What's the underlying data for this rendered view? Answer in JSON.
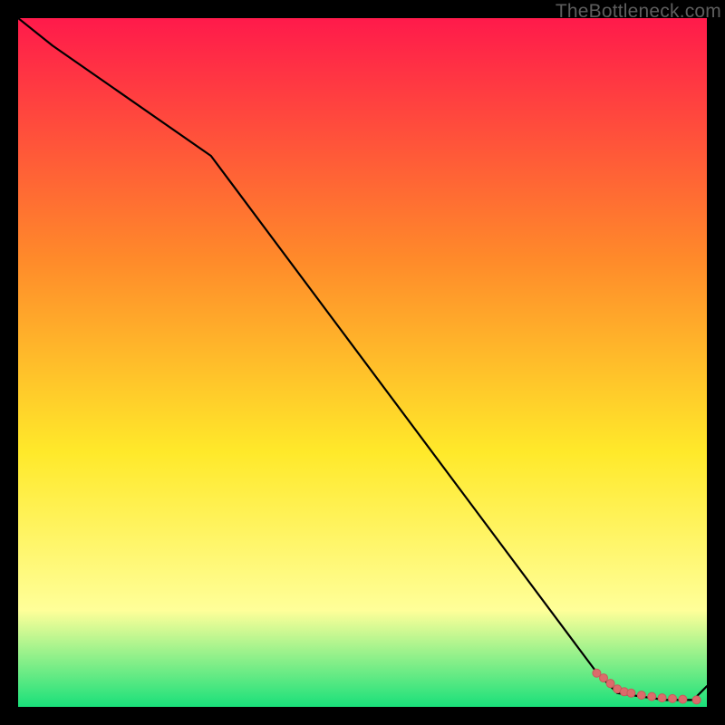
{
  "watermark": "TheBottleneck.com",
  "colors": {
    "gradient_top": "#ff1a4b",
    "gradient_mid1": "#ff8a2a",
    "gradient_mid2": "#ffe92a",
    "gradient_mid3": "#ffff99",
    "gradient_bottom": "#19e07a",
    "line": "#000000",
    "marker_fill": "#dc6b6b",
    "marker_stroke": "#c85a5a"
  },
  "chart_data": {
    "type": "line",
    "title": "",
    "xlabel": "",
    "ylabel": "",
    "xlim": [
      0,
      100
    ],
    "ylim": [
      0,
      100
    ],
    "series": [
      {
        "name": "curve",
        "x": [
          0,
          5,
          28,
          84,
          87,
          94,
          98,
          100
        ],
        "values": [
          100,
          96,
          80,
          5,
          2,
          1,
          1,
          3
        ]
      }
    ],
    "markers": {
      "name": "highlight-span",
      "x": [
        84.0,
        85.0,
        86.0,
        87.0,
        88.0,
        89.0,
        90.5,
        92.0,
        93.5,
        95.0,
        96.5,
        98.5
      ],
      "values": [
        4.9,
        4.2,
        3.4,
        2.6,
        2.2,
        2.0,
        1.7,
        1.5,
        1.3,
        1.2,
        1.1,
        1.0
      ]
    }
  }
}
